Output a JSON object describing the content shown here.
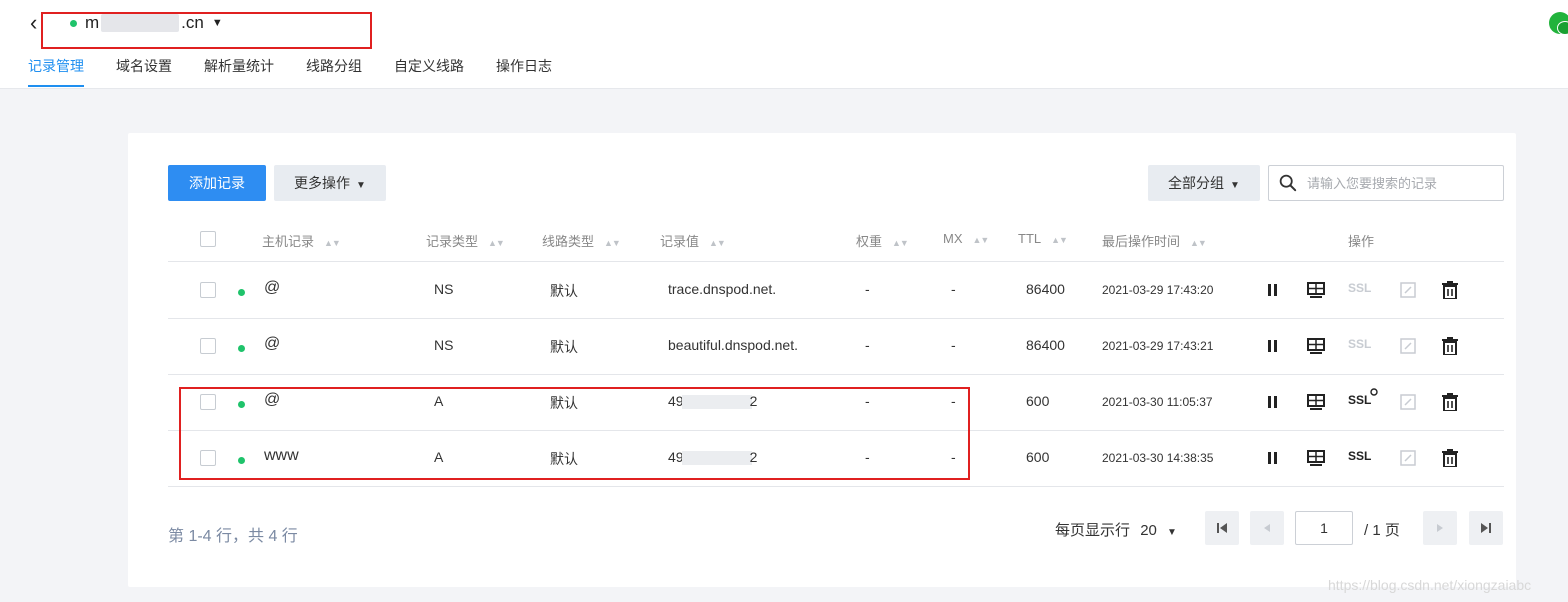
{
  "header": {
    "back_icon": "chevron-left-icon",
    "domain_prefix": "m",
    "domain_suffix": ".cn",
    "tabs": [
      {
        "label": "记录管理",
        "active": true
      },
      {
        "label": "域名设置"
      },
      {
        "label": "解析量统计"
      },
      {
        "label": "线路分组"
      },
      {
        "label": "自定义线路"
      },
      {
        "label": "操作日志"
      }
    ]
  },
  "toolbar": {
    "add_label": "添加记录",
    "more_label": "更多操作",
    "group_label": "全部分组",
    "search_placeholder": "请输入您要搜索的记录"
  },
  "table": {
    "headers": {
      "host": "主机记录",
      "type": "记录类型",
      "line": "线路类型",
      "value": "记录值",
      "weight": "权重",
      "mx": "MX",
      "ttl": "TTL",
      "time": "最后操作时间",
      "ops": "操作"
    },
    "rows": [
      {
        "host": "@",
        "type": "NS",
        "line": "默认",
        "value": "trace.dnspod.net.",
        "weight": "-",
        "mx": "-",
        "ttl": "86400",
        "time": "2021-03-29 17:43:20",
        "ssl": "SSL"
      },
      {
        "host": "@",
        "type": "NS",
        "line": "默认",
        "value": "beautiful.dnspod.net.",
        "weight": "-",
        "mx": "-",
        "ttl": "86400",
        "time": "2021-03-29 17:43:21",
        "ssl": "SSL"
      },
      {
        "host": "@",
        "type": "A",
        "line": "默认",
        "value_prefix": "49",
        "value_suffix": "2",
        "weight": "-",
        "mx": "-",
        "ttl": "600",
        "time": "2021-03-30 11:05:37",
        "ssl": "SSL"
      },
      {
        "host": "www",
        "type": "A",
        "line": "默认",
        "value_prefix": "49",
        "value_suffix": "2",
        "weight": "-",
        "mx": "-",
        "ttl": "600",
        "time": "2021-03-30 14:38:35",
        "ssl": "SSL"
      }
    ]
  },
  "footer": {
    "count_text": "第 1-4 行，共 4 行",
    "page_size_label": "每页显示行",
    "page_size_value": "20",
    "current_page": "1",
    "total_pages_text": "/ 1 页"
  },
  "watermark": "https://blog.csdn.net/xiongzaiabc",
  "colors": {
    "accent": "#2e8df2",
    "status_ok": "#1fc36b",
    "annotation": "#e02020"
  }
}
